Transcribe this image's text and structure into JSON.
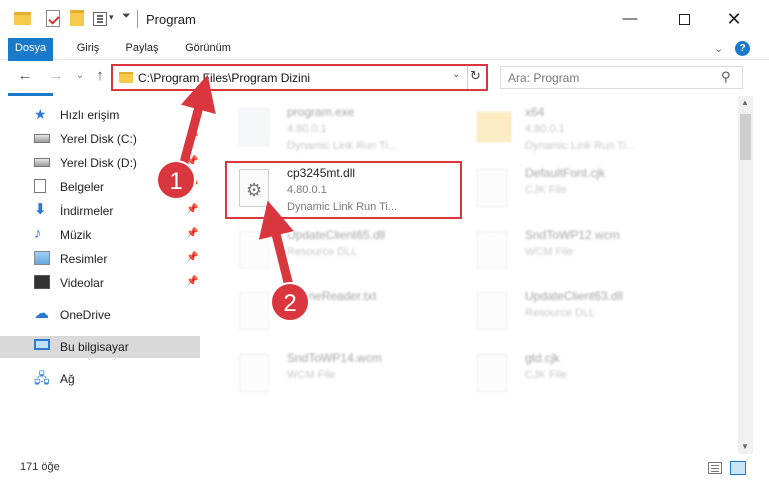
{
  "window": {
    "title": "Program",
    "minimize_glyph": "—",
    "close_glyph": "✕"
  },
  "quick_access_toolbar": {
    "icons": [
      "folder-icon",
      "properties-icon",
      "new-folder-icon",
      "view-icon"
    ],
    "dropdown_glyph": "▾",
    "customize_glyph": "⏷"
  },
  "ribbon": {
    "tabs": [
      "Dosya",
      "Giriş",
      "Paylaş",
      "Görünüm"
    ],
    "expand_glyph": "⌄",
    "help_glyph": "?"
  },
  "nav": {
    "back_glyph": "←",
    "forward_glyph": "→",
    "recent_glyph": "⌄",
    "up_glyph": "↑",
    "address": "C:\\Program Files\\Program Dizini",
    "address_dropdown_glyph": "⌄",
    "refresh_glyph": "↻",
    "search_placeholder": "Ara: Program",
    "search_glyph": "⚲"
  },
  "sidebar": {
    "pin_glyph": "📌",
    "items": [
      {
        "label": "Hızlı erişim",
        "icon": "star-icon",
        "glyph": "★",
        "pinned": false
      },
      {
        "label": "Yerel Disk (C:)",
        "icon": "disk-icon",
        "pinned": true
      },
      {
        "label": "Yerel Disk (D:)",
        "icon": "disk-icon",
        "pinned": true
      },
      {
        "label": "Belgeler",
        "icon": "document-icon",
        "pinned": true
      },
      {
        "label": "İndirmeler",
        "icon": "download-icon",
        "glyph": "⬇",
        "pinned": true
      },
      {
        "label": "Müzik",
        "icon": "music-icon",
        "glyph": "♪",
        "pinned": true
      },
      {
        "label": "Resimler",
        "icon": "pictures-icon",
        "pinned": true
      },
      {
        "label": "Videolar",
        "icon": "videos-icon",
        "pinned": true
      },
      {
        "label": "OneDrive",
        "icon": "cloud-icon",
        "glyph": "☁"
      },
      {
        "label": "Bu bilgisayar",
        "icon": "computer-icon",
        "selected": true
      },
      {
        "label": "Ağ",
        "icon": "network-icon",
        "glyph": "🖧"
      }
    ]
  },
  "files": [
    {
      "name": "program.exe",
      "version": "4.80.0.1",
      "desc": "Dynamic Link Run Ti...",
      "icon": "exe-icon",
      "blurred": true
    },
    {
      "name": "x64",
      "version": "4.80.0.1",
      "desc": "Dynamic Link Run Ti...",
      "icon": "folder-icon",
      "blurred": true
    },
    {
      "name": "cp3245mt.dll",
      "version": "4.80.0.1",
      "desc": "Dynamic Link Run Ti...",
      "icon": "dll-gear-icon",
      "highlighted": true,
      "glyph": "⚙"
    },
    {
      "name": "DefaultFont.cjk",
      "version": "CJK File",
      "desc": "",
      "icon": "file-icon",
      "blurred": true
    },
    {
      "name": "UpdateClient65.dll",
      "version": "Resource DLL",
      "desc": "",
      "icon": "file-icon",
      "blurred": true
    },
    {
      "name": "SndToWP12.wcm",
      "version": "WCM File",
      "desc": "",
      "icon": "file-icon",
      "blurred": true
    },
    {
      "name": "OnlineReader.txt",
      "version": "File",
      "desc": "",
      "icon": "file-icon",
      "blurred": true
    },
    {
      "name": "UpdateClient63.dll",
      "version": "Resource DLL",
      "desc": "",
      "icon": "file-icon",
      "blurred": true
    },
    {
      "name": "SndToWP14.wcm",
      "version": "WCM File",
      "desc": "",
      "icon": "file-icon",
      "blurred": true
    },
    {
      "name": "gtd.cjk",
      "version": "CJK File",
      "desc": "",
      "icon": "file-icon",
      "blurred": true
    }
  ],
  "scrollbar": {
    "up_glyph": "▲",
    "down_glyph": "▼"
  },
  "status": {
    "count": "171 öğe"
  },
  "annotations": {
    "steps": [
      "1",
      "2"
    ],
    "highlight_color": "#d9363e",
    "arrow_color": "#d9363e"
  },
  "colors": {
    "accent": "#1979ca",
    "selection": "#d9d9d9"
  }
}
